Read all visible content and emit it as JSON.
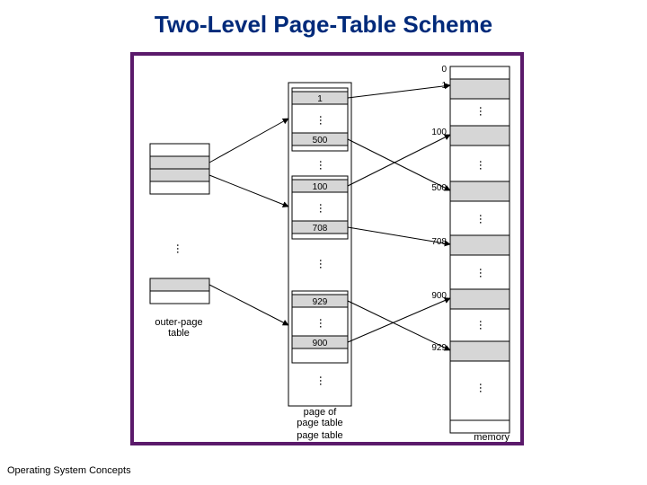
{
  "title": "Two-Level Page-Table Scheme",
  "footer": "Operating System Concepts",
  "labels": {
    "outer_page_table": "outer-page\ntable",
    "page_of_page_table": "page of\npage table",
    "page_table": "page table",
    "memory": "memory"
  },
  "inner_entries": [
    "1",
    "500",
    "100",
    "708",
    "929",
    "900"
  ],
  "memory_labels": [
    "0",
    "1",
    "100",
    "500",
    "708",
    "900",
    "929"
  ],
  "arrows": {
    "outer_to_inner": [
      {
        "from_entry": 0,
        "to_inner_entry": "1"
      },
      {
        "from_entry": 1,
        "to_inner_entry": "100"
      },
      {
        "from_entry": 2,
        "to_inner_entry": "929"
      }
    ],
    "inner_to_memory": [
      {
        "inner_entry": "1",
        "memory_label": "1"
      },
      {
        "inner_entry": "500",
        "memory_label": "500"
      },
      {
        "inner_entry": "100",
        "memory_label": "100"
      },
      {
        "inner_entry": "708",
        "memory_label": "708"
      },
      {
        "inner_entry": "929",
        "memory_label": "929"
      },
      {
        "inner_entry": "900",
        "memory_label": "900"
      }
    ]
  }
}
